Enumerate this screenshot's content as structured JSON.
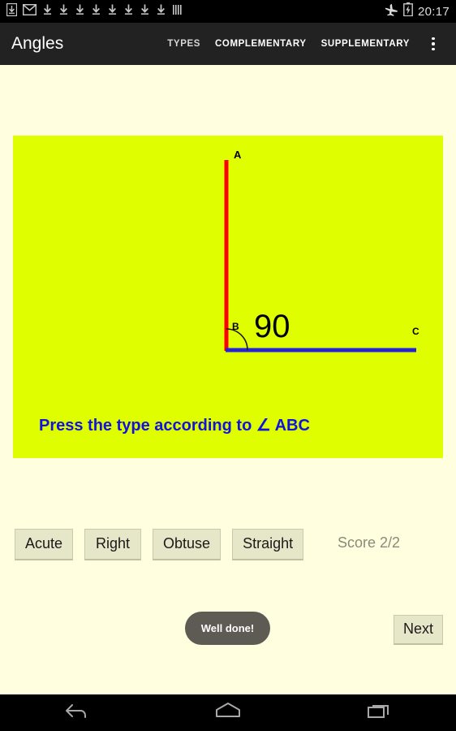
{
  "status_bar": {
    "background": "#000000",
    "left_icons": [
      {
        "name": "download-boxed-icon",
        "label": "download-complete"
      },
      {
        "name": "gmail-icon",
        "label": "gmail"
      },
      {
        "name": "download-icon",
        "label": "download"
      },
      {
        "name": "download-icon",
        "label": "download"
      },
      {
        "name": "download-icon",
        "label": "download"
      },
      {
        "name": "download-icon",
        "label": "download"
      },
      {
        "name": "download-icon",
        "label": "download"
      },
      {
        "name": "download-icon",
        "label": "download"
      },
      {
        "name": "download-icon",
        "label": "download"
      },
      {
        "name": "download-icon",
        "label": "download"
      },
      {
        "name": "more-notifications-icon",
        "label": "more"
      }
    ],
    "right_icons": [
      {
        "name": "airplane-mode-icon",
        "label": "airplane-mode"
      },
      {
        "name": "battery-charging-icon",
        "label": "battery-charging"
      }
    ],
    "clock": "20:17"
  },
  "action_bar": {
    "background": "#222222",
    "title": "Angles",
    "menu_items": [
      {
        "label": "TYPES",
        "name": "tab-types",
        "selected": true
      },
      {
        "label": "COMPLEMENTARY",
        "name": "tab-complementary",
        "selected": false
      },
      {
        "label": "SUPPLEMENTARY",
        "name": "tab-supplementary",
        "selected": false
      }
    ],
    "overflow_label": "More options"
  },
  "page": {
    "background": "#FFFFE0"
  },
  "canvas": {
    "background": "#DFFF00",
    "ray_a_color": "#FF0000",
    "ray_c_color": "#2222DD",
    "arc_color": "#1A1A1A",
    "vertex_label": "B",
    "point_a_label": "A",
    "point_c_label": "C",
    "angle_value": "90",
    "angle_text_color": "#000000",
    "instruction": "Press the type according to ∠ ABC",
    "instruction_color": "#1212E0"
  },
  "answers": {
    "options": [
      {
        "label": "Acute",
        "name": "answer-acute"
      },
      {
        "label": "Right",
        "name": "answer-right"
      },
      {
        "label": "Obtuse",
        "name": "answer-obtuse"
      },
      {
        "label": "Straight",
        "name": "answer-straight"
      }
    ],
    "button_fill": "#E6E6C8"
  },
  "score": {
    "text": "Score 2/2",
    "correct": 2,
    "total": 2,
    "color": "#8A8A7A"
  },
  "toast": {
    "message": "Well done!",
    "background": "#5E5B55"
  },
  "next": {
    "label": "Next"
  },
  "nav_bar": {
    "background": "#000000",
    "buttons": [
      {
        "name": "nav-back-icon",
        "label": "Back"
      },
      {
        "name": "nav-home-icon",
        "label": "Home"
      },
      {
        "name": "nav-recents-icon",
        "label": "Recent apps"
      }
    ]
  }
}
